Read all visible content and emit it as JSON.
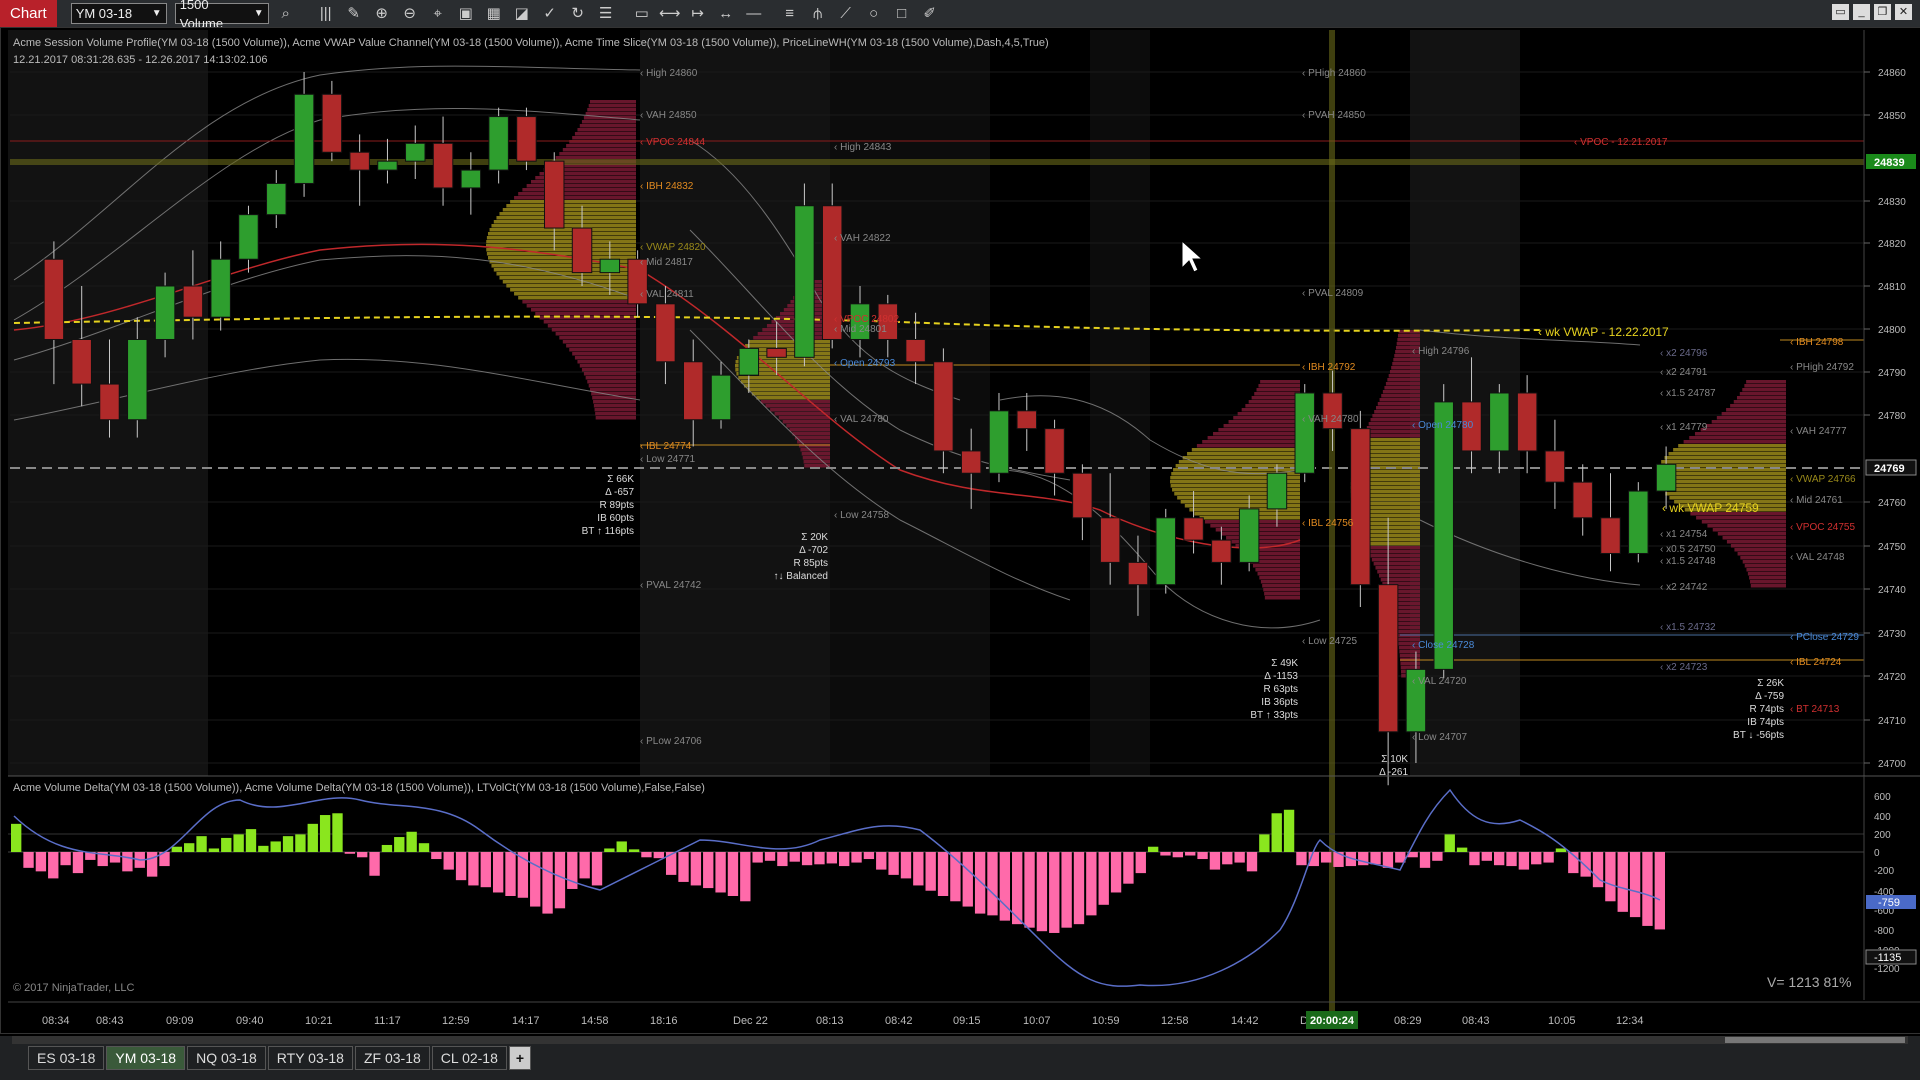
{
  "toolbar": {
    "chart_tab": "Chart",
    "instrument": "YM 03-18",
    "interval": "1500 Volume",
    "icons": [
      "search-icon",
      "bar-chart-icon",
      "pencil-icon",
      "zoom-in-icon",
      "zoom-out-icon",
      "crosshair-icon",
      "snapshot-icon",
      "indicators-icon",
      "strategies-icon",
      "shapes-icon",
      "refresh-icon",
      "list-icon",
      "ruler-icon",
      "line-icon",
      "ray-icon",
      "extended-line-icon",
      "horizontal-line-icon",
      "fib-icon",
      "pitchfork-icon",
      "arrow-line-icon",
      "ellipse-icon",
      "rectangle-icon",
      "draw-icon"
    ]
  },
  "main_panel": {
    "header": "Acme Session Volume Profile(YM 03-18 (1500 Volume)), Acme VWAP Value Channel(YM 03-18 (1500 Volume)), Acme Time Slice(YM 03-18 (1500 Volume)), PriceLineWH(YM 03-18 (1500 Volume),Dash,4,5,True)",
    "range": "12.21.2017 08:31:28.635 - 12.26.2017 14:13:02.106",
    "price_axis": [
      "24860",
      "24850",
      "24830",
      "24820",
      "24810",
      "24800",
      "24790",
      "24780",
      "24760",
      "24750",
      "24740",
      "24730",
      "24720",
      "24710",
      "24700"
    ],
    "current_price": "24839",
    "last_price": "24769",
    "labels": {
      "high1": "High 24860",
      "vah1": "VAH 24850",
      "vpoc1": "VPOC 24844",
      "ibh1": "IBH 24832",
      "vwap1": "VWAP 24820",
      "mid1": "Mid 24817",
      "val1": "VAL 24811",
      "ibl1": "IBL 24774",
      "low1": "Low 24771",
      "pval1": "PVAL 24742",
      "plow1": "PLow 24706",
      "high2": "High 24843",
      "vah2": "VAH 24822",
      "vpoc2": "VPOC 24802",
      "mid2": "Mid 24801",
      "open2": "Open 24793",
      "val2": "VAL 24780",
      "low2": "Low 24758",
      "phigh": "PHigh 24860",
      "pvah": "PVAH 24850",
      "pval2": "PVAL 24809",
      "vpoc_wk": "VPOC - 12.21.2017",
      "ibh3": "IBH 24792",
      "vah3": "VAH 24780",
      "ibl3": "IBL 24756",
      "low3": "Low 24725",
      "high4": "High 24796",
      "open4": "Open 24780",
      "close4": "Close 24728",
      "val4": "VAL 24720",
      "low4": "Low 24707",
      "x2a": "x2 24796",
      "x2b": "x2 24791",
      "x15a": "x1.5 24787",
      "x1a": "x1 24779",
      "x1b": "x1 24754",
      "x05": "x0.5 24750",
      "x15b": "x1.5 24748",
      "x2c": "x2 24742",
      "x15c": "x1.5 24732",
      "x2d": "x2 24723",
      "ibh_r": "IBH 24798",
      "phigh_r": "PHigh 24792",
      "vah_r": "VAH 24777",
      "vwap_r": "VWAP 24766",
      "mid_r": "Mid 24761",
      "vpoc_r": "VPOC 24755",
      "val_r": "VAL 24748",
      "pclose_r": "PClose 24729",
      "ibl_r": "IBL 24724",
      "bt_r": "BT 24713",
      "wk_vwap": "wk VWAP - 12.22.2017",
      "wk_vwap2": "wk VWAP 24759"
    },
    "stats": {
      "s1": [
        "Σ 66K",
        "Δ -657",
        "R 89pts",
        "IB 60pts",
        "BT ↑ 116pts"
      ],
      "s2": [
        "Σ 20K",
        "Δ -702",
        "R 85pts",
        "↑↓ Balanced"
      ],
      "s3": [
        "Σ 49K",
        "Δ -1153",
        "R 63pts",
        "IB 36pts",
        "BT ↑ 33pts"
      ],
      "s4": [
        "Σ 10K",
        "Δ -261"
      ],
      "s5": [
        "Σ 26K",
        "Δ -759",
        "R 74pts",
        "IB 74pts",
        "BT ↓ -56pts"
      ]
    }
  },
  "indicator_panel": {
    "header": "Acme Volume Delta(YM 03-18 (1500 Volume)), Acme Volume Delta(YM 03-18 (1500 Volume)), LTVolCt(YM 03-18 (1500 Volume),False,False)",
    "axis": [
      "600",
      "400",
      "200",
      "0",
      "-200",
      "-400",
      "-600",
      "-800",
      "-1000",
      "-1200"
    ],
    "current_delta": "-759",
    "total_delta": "-1135",
    "vinfo": "V= 1213 81%",
    "copyright": "© 2017 NinjaTrader, LLC",
    "delta_values": [
      320,
      -180,
      -220,
      -300,
      -150,
      -240,
      -90,
      -160,
      -120,
      -220,
      -180,
      -280,
      -160,
      60,
      100,
      180,
      40,
      160,
      200,
      260,
      70,
      120,
      180,
      200,
      320,
      420,
      440,
      -20,
      -60,
      -270,
      80,
      170,
      230,
      100,
      -80,
      -200,
      -320,
      -380,
      -400,
      -460,
      -500,
      -520,
      -620,
      -700,
      -640,
      -420,
      -300,
      -380,
      40,
      120,
      30,
      -60,
      -70,
      -260,
      -340,
      -380,
      -410,
      -460,
      -500,
      -560,
      -120,
      -100,
      -160,
      -110,
      -150,
      -140,
      -130,
      -160,
      -120,
      -80,
      -200,
      -260,
      -300,
      -380,
      -440,
      -500,
      -560,
      -620,
      -700,
      -720,
      -780,
      -820,
      -860,
      -900,
      -920,
      -860,
      -820,
      -720,
      -600,
      -460,
      -360,
      -240,
      60,
      -40,
      -60,
      -40,
      -80,
      -200,
      -140,
      -120,
      -220,
      200,
      440,
      480,
      -150,
      -160,
      -120,
      -170,
      -160,
      -150,
      -140,
      -180,
      -120,
      -60,
      -180,
      -100,
      200,
      50,
      -150,
      -100,
      -150,
      -160,
      -200,
      -140,
      -120,
      40,
      -240,
      -280,
      -400,
      -560,
      -680,
      -740,
      -840,
      -880
    ]
  },
  "time_axis": [
    "08:34",
    "08:43",
    "09:09",
    "09:40",
    "10:21",
    "11:17",
    "12:59",
    "14:17",
    "14:58",
    "18:16",
    "Dec 22",
    "08:13",
    "08:42",
    "09:15",
    "10:07",
    "10:59",
    "12:58",
    "14:42",
    "De",
    "08:29",
    "08:43",
    "10:05",
    "12:34"
  ],
  "time_cursor": "20:00:24",
  "instrument_tabs": [
    "ES 03-18",
    "YM 03-18",
    "NQ 03-18",
    "RTY 03-18",
    "ZF 03-18",
    "CL 02-18",
    "+"
  ],
  "active_tab": "YM 03-18",
  "chart_data": {
    "type": "candlestick",
    "ylim": [
      24700,
      24865
    ],
    "series": [
      {
        "name": "candles",
        "values": [
          [
            24818,
            24822,
            24790,
            24800
          ],
          [
            24800,
            24812,
            24785,
            24790
          ],
          [
            24790,
            24800,
            24778,
            24782
          ],
          [
            24782,
            24805,
            24778,
            24800
          ],
          [
            24800,
            24815,
            24796,
            24812
          ],
          [
            24812,
            24820,
            24800,
            24805
          ],
          [
            24805,
            24822,
            24802,
            24818
          ],
          [
            24818,
            24830,
            24815,
            24828
          ],
          [
            24828,
            24838,
            24825,
            24835
          ],
          [
            24835,
            24860,
            24832,
            24855
          ],
          [
            24855,
            24858,
            24840,
            24842
          ],
          [
            24842,
            24846,
            24830,
            24838
          ],
          [
            24838,
            24845,
            24835,
            24840
          ],
          [
            24840,
            24848,
            24836,
            24844
          ],
          [
            24844,
            24850,
            24830,
            24834
          ],
          [
            24834,
            24842,
            24828,
            24838
          ],
          [
            24838,
            24852,
            24835,
            24850
          ],
          [
            24850,
            24852,
            24838,
            24840
          ],
          [
            24840,
            24842,
            24820,
            24825
          ],
          [
            24825,
            24830,
            24812,
            24815
          ],
          [
            24815,
            24822,
            24810,
            24818
          ],
          [
            24818,
            24820,
            24805,
            24808
          ],
          [
            24808,
            24812,
            24790,
            24795
          ],
          [
            24795,
            24800,
            24776,
            24782
          ],
          [
            24782,
            24795,
            24780,
            24792
          ],
          [
            24792,
            24800,
            24788,
            24798
          ],
          [
            24798,
            24804,
            24792,
            24796
          ],
          [
            24796,
            24835,
            24794,
            24830
          ],
          [
            24830,
            24835,
            24798,
            24800
          ],
          [
            24800,
            24812,
            24796,
            24808
          ],
          [
            24808,
            24810,
            24796,
            24800
          ],
          [
            24800,
            24806,
            24790,
            24795
          ],
          [
            24795,
            24798,
            24770,
            24775
          ],
          [
            24775,
            24780,
            24762,
            24770
          ],
          [
            24770,
            24788,
            24768,
            24784
          ],
          [
            24784,
            24788,
            24775,
            24780
          ],
          [
            24780,
            24782,
            24765,
            24770
          ],
          [
            24770,
            24772,
            24755,
            24760
          ],
          [
            24760,
            24770,
            24745,
            24750
          ],
          [
            24750,
            24756,
            24738,
            24745
          ],
          [
            24745,
            24762,
            24743,
            24760
          ],
          [
            24760,
            24766,
            24752,
            24755
          ],
          [
            24755,
            24758,
            24745,
            24750
          ],
          [
            24750,
            24765,
            24748,
            24762
          ],
          [
            24762,
            24772,
            24758,
            24770
          ],
          [
            24770,
            24790,
            24768,
            24788
          ],
          [
            24788,
            24793,
            24775,
            24780
          ],
          [
            24780,
            24784,
            24740,
            24745
          ],
          [
            24745,
            24760,
            24700,
            24712
          ],
          [
            24712,
            24730,
            24705,
            24726
          ],
          [
            24726,
            24790,
            24724,
            24786
          ],
          [
            24786,
            24796,
            24770,
            24775
          ],
          [
            24775,
            24790,
            24770,
            24788
          ],
          [
            24788,
            24792,
            24770,
            24775
          ],
          [
            24775,
            24782,
            24762,
            24768
          ],
          [
            24768,
            24772,
            24756,
            24760
          ],
          [
            24760,
            24770,
            24748,
            24752
          ],
          [
            24752,
            24768,
            24750,
            24766
          ],
          [
            24766,
            24776,
            24762,
            24772
          ]
        ]
      }
    ]
  }
}
